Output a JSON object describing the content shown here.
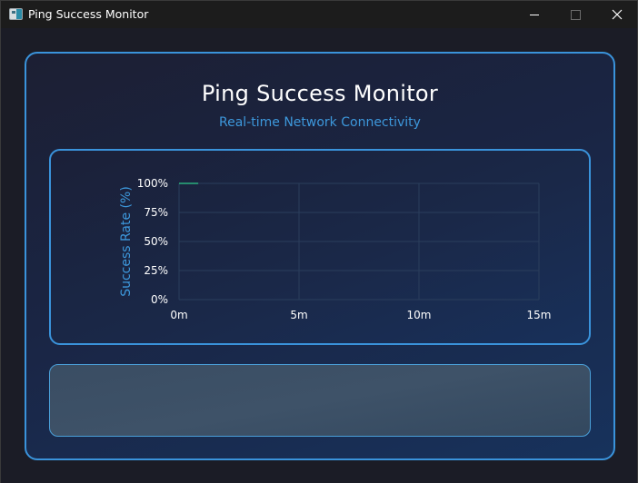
{
  "window": {
    "title": "Ping Success Monitor"
  },
  "header": {
    "title": "Ping Success Monitor",
    "subtitle": "Real-time Network Connectivity"
  },
  "colors": {
    "accent": "#3a93db",
    "line": "#2ecc8a",
    "grid": "#2a3e5c"
  },
  "chart_data": {
    "type": "line",
    "ylabel": "Success Rate (%)",
    "xlabel": "",
    "x_tick_labels": [
      "0m",
      "5m",
      "10m",
      "15m"
    ],
    "y_tick_labels": [
      "100%",
      "75%",
      "50%",
      "25%",
      "0%"
    ],
    "xlim": [
      0,
      15
    ],
    "ylim": [
      0,
      100
    ],
    "grid": true,
    "series": [
      {
        "x": [
          0,
          0.8
        ],
        "y": [
          100,
          100
        ]
      }
    ]
  }
}
